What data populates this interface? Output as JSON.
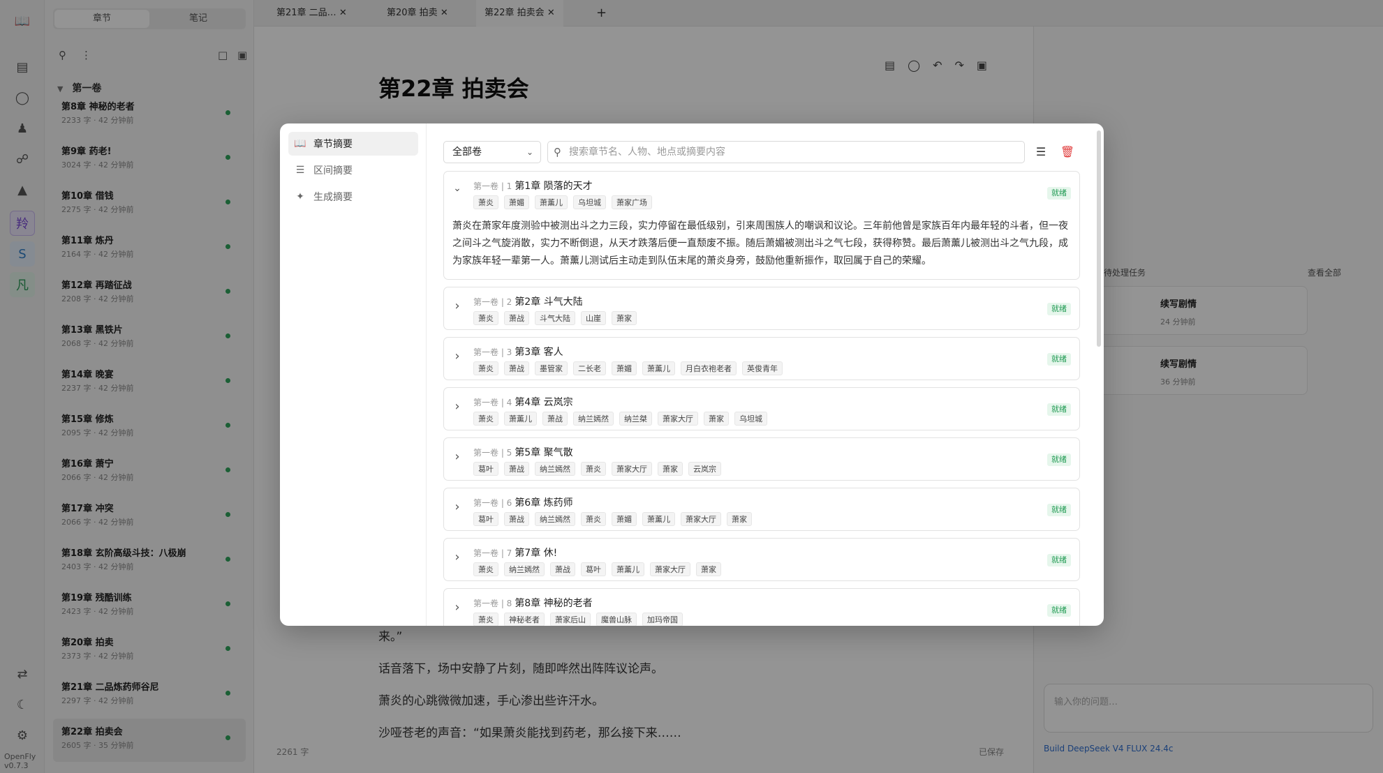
{
  "app": {
    "version": "OpenFly v0.7.3"
  },
  "rail": {
    "icons": [
      "book-icon",
      "layers-icon",
      "globe-icon",
      "user-icon",
      "link-icon",
      "chart-icon"
    ],
    "active_label": "羚",
    "blue_label": "S",
    "green_label": "凡"
  },
  "sidebar": {
    "tabs": [
      "章节",
      "笔记"
    ],
    "volume": "第一卷",
    "chapters": [
      {
        "title": "第8章 神秘的老者",
        "meta": "2233 字 · 42 分钟前"
      },
      {
        "title": "第9章 药老!",
        "meta": "3024 字 · 42 分钟前"
      },
      {
        "title": "第10章 借钱",
        "meta": "2275 字 · 42 分钟前"
      },
      {
        "title": "第11章 炼丹",
        "meta": "2164 字 · 42 分钟前"
      },
      {
        "title": "第12章 再踏征战",
        "meta": "2208 字 · 42 分钟前"
      },
      {
        "title": "第13章 黑铁片",
        "meta": "2068 字 · 42 分钟前"
      },
      {
        "title": "第14章 晚宴",
        "meta": "2237 字 · 42 分钟前"
      },
      {
        "title": "第15章 修炼",
        "meta": "2095 字 · 42 分钟前"
      },
      {
        "title": "第16章 萧宁",
        "meta": "2066 字 · 42 分钟前"
      },
      {
        "title": "第17章 冲突",
        "meta": "2066 字 · 42 分钟前"
      },
      {
        "title": "第18章 玄阶高级斗技：八极崩",
        "meta": "2403 字 · 42 分钟前"
      },
      {
        "title": "第19章 残酷训练",
        "meta": "2423 字 · 42 分钟前"
      },
      {
        "title": "第20章 拍卖",
        "meta": "2373 字 · 42 分钟前"
      },
      {
        "title": "第21章 二品炼药师谷尼",
        "meta": "2297 字 · 42 分钟前"
      },
      {
        "title": "第22章 拍卖会",
        "meta": "2605 字 · 35 分钟前"
      }
    ]
  },
  "tabs": [
    "第21章 二品…",
    "第20章 拍卖",
    "第22章 拍卖会"
  ],
  "editor": {
    "title": "第22章 拍卖会",
    "paragraphs": [
      "来。”",
      "话音落下，场中安静了片刻，随即哗然出阵阵议论声。",
      "萧炎的心跳微微加速，手心渗出些许汗水。",
      "沙哑苍老的声音：“如果萧炎能找到药老，那么接下来……"
    ],
    "word_count": "2261 字",
    "save_state": "已保存"
  },
  "right_panel": {
    "heading": "待处理任务",
    "heading_right": "查看全部",
    "tasks": [
      {
        "title": "续写剧情",
        "meta": "24 分钟前"
      },
      {
        "title": "续写剧情",
        "meta": "36 分钟前"
      }
    ],
    "input_placeholder": "输入你的问题…",
    "footer": "Build  DeepSeek V4 FLUX 24.4c"
  },
  "modal": {
    "nav": [
      {
        "label": "章节摘要",
        "icon": "book-open-icon"
      },
      {
        "label": "区间摘要",
        "icon": "layers-icon"
      },
      {
        "label": "生成摘要",
        "icon": "sparkles-icon"
      }
    ],
    "filter": {
      "selected": "全部卷"
    },
    "search": {
      "placeholder": "搜索章节名、人物、地点或摘要内容",
      "value": ""
    },
    "status_label": "就绪",
    "chapters": [
      {
        "vol": "第一卷 | 1",
        "title": "第1章 陨落的天才",
        "tags": [
          "萧炎",
          "萧媚",
          "萧薰儿",
          "乌坦城",
          "萧家广场"
        ],
        "expanded": true,
        "summary": "萧炎在萧家年度测验中被测出斗之力三段，实力停留在最低级别，引来周围族人的嘲讽和议论。三年前他曾是家族百年内最年轻的斗者，但一夜之间斗之气旋消散，实力不断倒退，从天才跌落后便一直颓废不振。随后萧媚被测出斗之气七段，获得称赞。最后萧薰儿被测出斗之气九段，成为家族年轻一辈第一人。萧薰儿测试后主动走到队伍末尾的萧炎身旁，鼓励他重新振作，取回属于自己的荣耀。"
      },
      {
        "vol": "第一卷 | 2",
        "title": "第2章 斗气大陆",
        "tags": [
          "萧炎",
          "萧战",
          "斗气大陆",
          "山崖",
          "萧家"
        ]
      },
      {
        "vol": "第一卷 | 3",
        "title": "第3章 客人",
        "tags": [
          "萧炎",
          "萧战",
          "墨管家",
          "二长老",
          "萧媚",
          "萧薰儿",
          "月白衣袍老者",
          "英俊青年"
        ]
      },
      {
        "vol": "第一卷 | 4",
        "title": "第4章 云岚宗",
        "tags": [
          "萧炎",
          "萧薰儿",
          "萧战",
          "纳兰嫣然",
          "纳兰桀",
          "萧家大厅",
          "萧家",
          "乌坦城"
        ]
      },
      {
        "vol": "第一卷 | 5",
        "title": "第5章 聚气散",
        "tags": [
          "葛叶",
          "萧战",
          "纳兰嫣然",
          "萧炎",
          "萧家大厅",
          "萧家",
          "云岚宗"
        ]
      },
      {
        "vol": "第一卷 | 6",
        "title": "第6章 炼药师",
        "tags": [
          "葛叶",
          "萧战",
          "纳兰嫣然",
          "萧炎",
          "萧媚",
          "萧薰儿",
          "萧家大厅",
          "萧家"
        ]
      },
      {
        "vol": "第一卷 | 7",
        "title": "第7章 休!",
        "tags": [
          "萧炎",
          "纳兰嫣然",
          "萧战",
          "葛叶",
          "萧薰儿",
          "萧家大厅",
          "萧家"
        ]
      },
      {
        "vol": "第一卷 | 8",
        "title": "第8章 神秘的老者",
        "tags": [
          "萧炎",
          "神秘老者",
          "萧家后山",
          "魔兽山脉",
          "加玛帝国"
        ]
      }
    ]
  },
  "colors": {
    "status_green": "#1f9a52",
    "delete_red": "#e03b3b",
    "overlay": "rgba(0,0,0,0.42)"
  }
}
